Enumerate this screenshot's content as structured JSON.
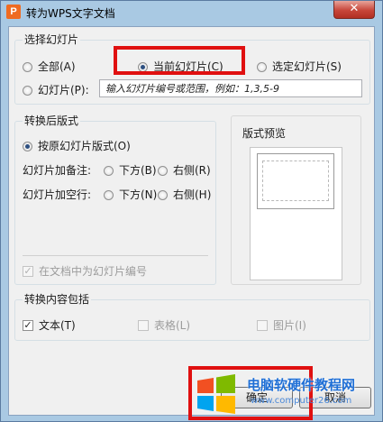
{
  "window": {
    "title": "转为WPS文字文档",
    "app_icon": "wps-p-icon",
    "close_glyph": "✕"
  },
  "slide_selection": {
    "legend": "选择幻灯片",
    "all": "全部(A)",
    "current": "当前幻灯片(C)",
    "selected": "选定幻灯片(S)",
    "slides": "幻灯片(P):",
    "range_placeholder": "输入幻灯片编号或范围，例如：1,3,5-9",
    "checked": "current"
  },
  "layout_after": {
    "legend": "转换后版式",
    "keep_original": "按原幻灯片版式(O)",
    "notes_label": "幻灯片加备注:",
    "notes_below": "下方(B)",
    "notes_right": "右侧(R)",
    "blank_label": "幻灯片加空行:",
    "blank_below": "下方(N)",
    "blank_right": "右侧(H)",
    "number_slides": "在文档中为幻灯片编号"
  },
  "preview": {
    "legend": "版式预览"
  },
  "content": {
    "legend": "转换内容包括",
    "text": "文本(T)",
    "table": "表格(L)",
    "picture": "图片(I)"
  },
  "buttons": {
    "ok": "确定",
    "cancel": "取消"
  },
  "watermark": {
    "text": "电脑软硬件教程网",
    "url": "www.computer26.com"
  },
  "colors": {
    "highlight": "#e01010",
    "title_bar": "#a9c9e3",
    "dialog_bg": "#f0f0f0"
  }
}
